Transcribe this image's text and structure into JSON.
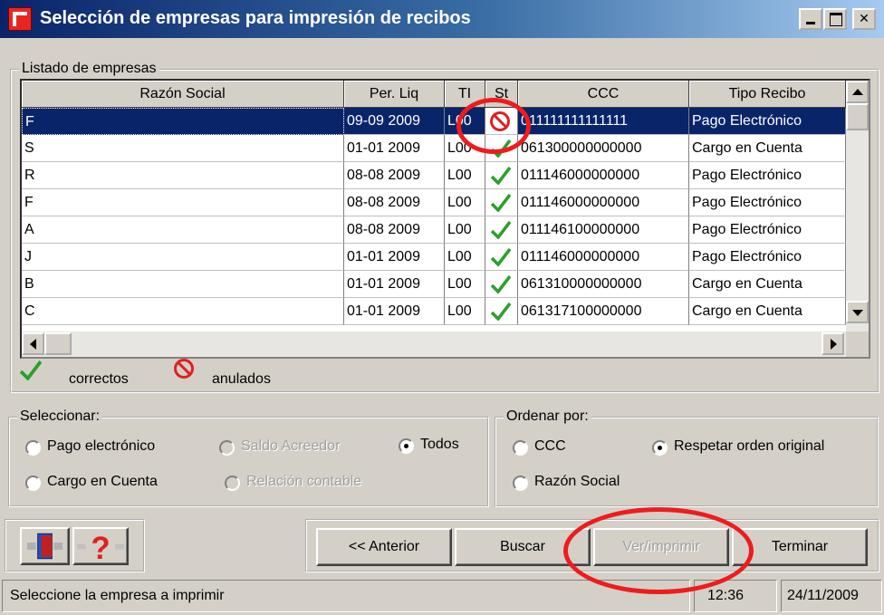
{
  "window": {
    "title": "Selección de empresas para impresión de recibos"
  },
  "list": {
    "group_title": "Listado de empresas",
    "columns": [
      "Razón Social",
      "Per. Liq",
      "TI",
      "St",
      "CCC",
      "Tipo Recibo"
    ],
    "rows": [
      {
        "razon": "F",
        "per": "09-09 2009",
        "ti": "L00",
        "status": "anulado",
        "ccc": "011111111111111",
        "tipo": "Pago Electrónico",
        "selected": true
      },
      {
        "razon": "S",
        "per": "01-01 2009",
        "ti": "L00",
        "status": "correcto",
        "ccc": "061300000000000",
        "tipo": "Cargo en Cuenta"
      },
      {
        "razon": "R",
        "per": "08-08 2009",
        "ti": "L00",
        "status": "correcto",
        "ccc": "011146000000000",
        "tipo": "Pago Electrónico"
      },
      {
        "razon": "F",
        "per": "08-08 2009",
        "ti": "L00",
        "status": "correcto",
        "ccc": "011146000000000",
        "tipo": "Pago Electrónico"
      },
      {
        "razon": "A",
        "per": "08-08 2009",
        "ti": "L00",
        "status": "correcto",
        "ccc": "011146100000000",
        "tipo": "Pago Electrónico"
      },
      {
        "razon": "J",
        "per": "01-01 2009",
        "ti": "L00",
        "status": "correcto",
        "ccc": "011146000000000",
        "tipo": "Pago Electrónico"
      },
      {
        "razon": "B",
        "per": "01-01 2009",
        "ti": "L00",
        "status": "correcto",
        "ccc": "061310000000000",
        "tipo": "Cargo en Cuenta"
      },
      {
        "razon": "C",
        "per": "01-01 2009",
        "ti": "L00",
        "status": "correcto",
        "ccc": "061317100000000",
        "tipo": "Cargo en Cuenta"
      }
    ]
  },
  "legend": {
    "correct_label": "correctos",
    "void_label": "anulados"
  },
  "seleccionar": {
    "title": "Seleccionar:",
    "pago_electronico": "Pago electrónico",
    "saldo_acreedor": "Saldo Acreedor",
    "todos": "Todos",
    "cargo_en_cuenta": "Cargo en  Cuenta",
    "relacion_contable": "Relación contable"
  },
  "ordenar": {
    "title": "Ordenar por:",
    "ccc": "CCC",
    "respetar": "Respetar orden original",
    "razon_social": "Razón Social"
  },
  "buttons": {
    "anterior": "<< Anterior",
    "buscar": "Buscar",
    "ver_imprimir": "Ver/imprimir",
    "terminar": "Terminar"
  },
  "status": {
    "message": "Seleccione la empresa a imprimir",
    "time": "12:36",
    "date": "24/11/2009"
  },
  "colors": {
    "selection": "#0a246a",
    "annotation": "#ee1c1c",
    "check": "#2aa02a",
    "void": "#e02020"
  }
}
